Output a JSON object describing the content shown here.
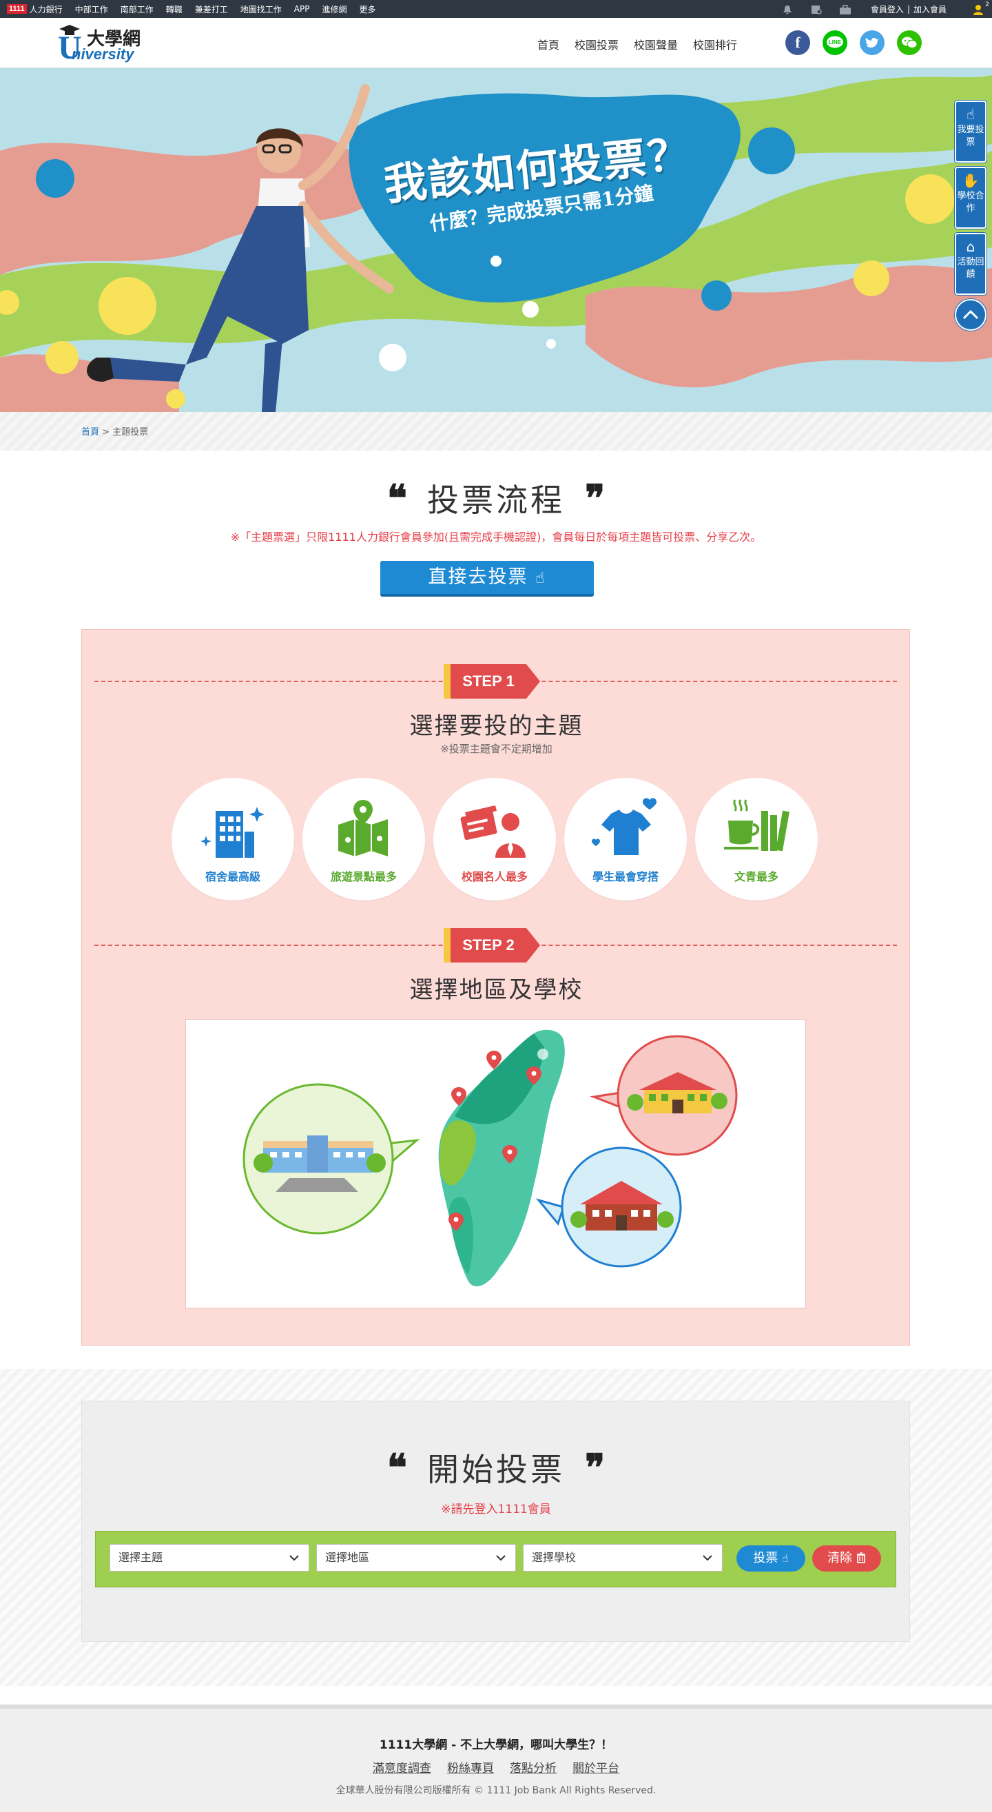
{
  "topbar": {
    "logo": "1111",
    "links": [
      "人力銀行",
      "中部工作",
      "南部工作",
      "轉職",
      "兼差打工",
      "地圖找工作",
      "APP",
      "進修網",
      "更多"
    ],
    "login": "會員登入",
    "join": "加入會員",
    "sep": "|",
    "user_badge": "2"
  },
  "header": {
    "brand_cn": "大學網",
    "brand_u": "U",
    "brand_en": "niversity",
    "nav": [
      "首頁",
      "校園投票",
      "校園聲量",
      "校園排行"
    ]
  },
  "banner": {
    "title": "我該如何投票？",
    "subtitle": "什麼？完成投票只需1分鐘"
  },
  "float_menu": {
    "vote": "我要投票",
    "cooperate": "學校合作",
    "feedback": "活動回饋"
  },
  "breadcrumb": {
    "home": "首頁",
    "sep": ">",
    "current": "主題投票"
  },
  "process": {
    "open_quote": "❝",
    "close_quote": "❞",
    "title": "投票流程",
    "notice": "※「主題票選」只限1111人力銀行會員參加(且需完成手機認證)，會員每日於每項主題皆可投票、分享乙次。",
    "go_button": "直接去投票"
  },
  "step1": {
    "tag": "STEP 1",
    "title": "選擇要投的主題",
    "note": "※投票主題會不定期增加",
    "topics": [
      {
        "label": "宿舍最高級",
        "color": "#1f7fd0",
        "icon": "building-icon"
      },
      {
        "label": "旅遊景點最多",
        "color": "#5aaa2e",
        "icon": "map-icon"
      },
      {
        "label": "校園名人最多",
        "color": "#e14b4b",
        "icon": "celebrity-icon"
      },
      {
        "label": "學生最會穿搭",
        "color": "#1f7fd0",
        "icon": "tshirt-icon"
      },
      {
        "label": "文青最多",
        "color": "#5aaa2e",
        "icon": "coffee-books-icon"
      }
    ]
  },
  "step2": {
    "tag": "STEP 2",
    "title": "選擇地區及學校"
  },
  "vote": {
    "open_quote": "❝",
    "close_quote": "❞",
    "title": "開始投票",
    "notice": "※請先登入1111會員",
    "select_topic": "選擇主題",
    "select_area": "選擇地區",
    "select_school": "選擇學校",
    "vote_button": "投票",
    "clear_button": "清除"
  },
  "footer": {
    "slogan": "1111大學網 - 不上大學網，哪叫大學生？！",
    "links": [
      "滿意度調查",
      "粉絲專頁",
      "落點分析",
      "關於平台"
    ],
    "copyright": "全球華人股份有限公司版權所有 © 1111 Job Bank All Rights Reserved."
  },
  "colors": {
    "brand_blue": "#1f6fb8",
    "accent_red": "#e14b4b",
    "vote_green": "#9fcf4e"
  }
}
